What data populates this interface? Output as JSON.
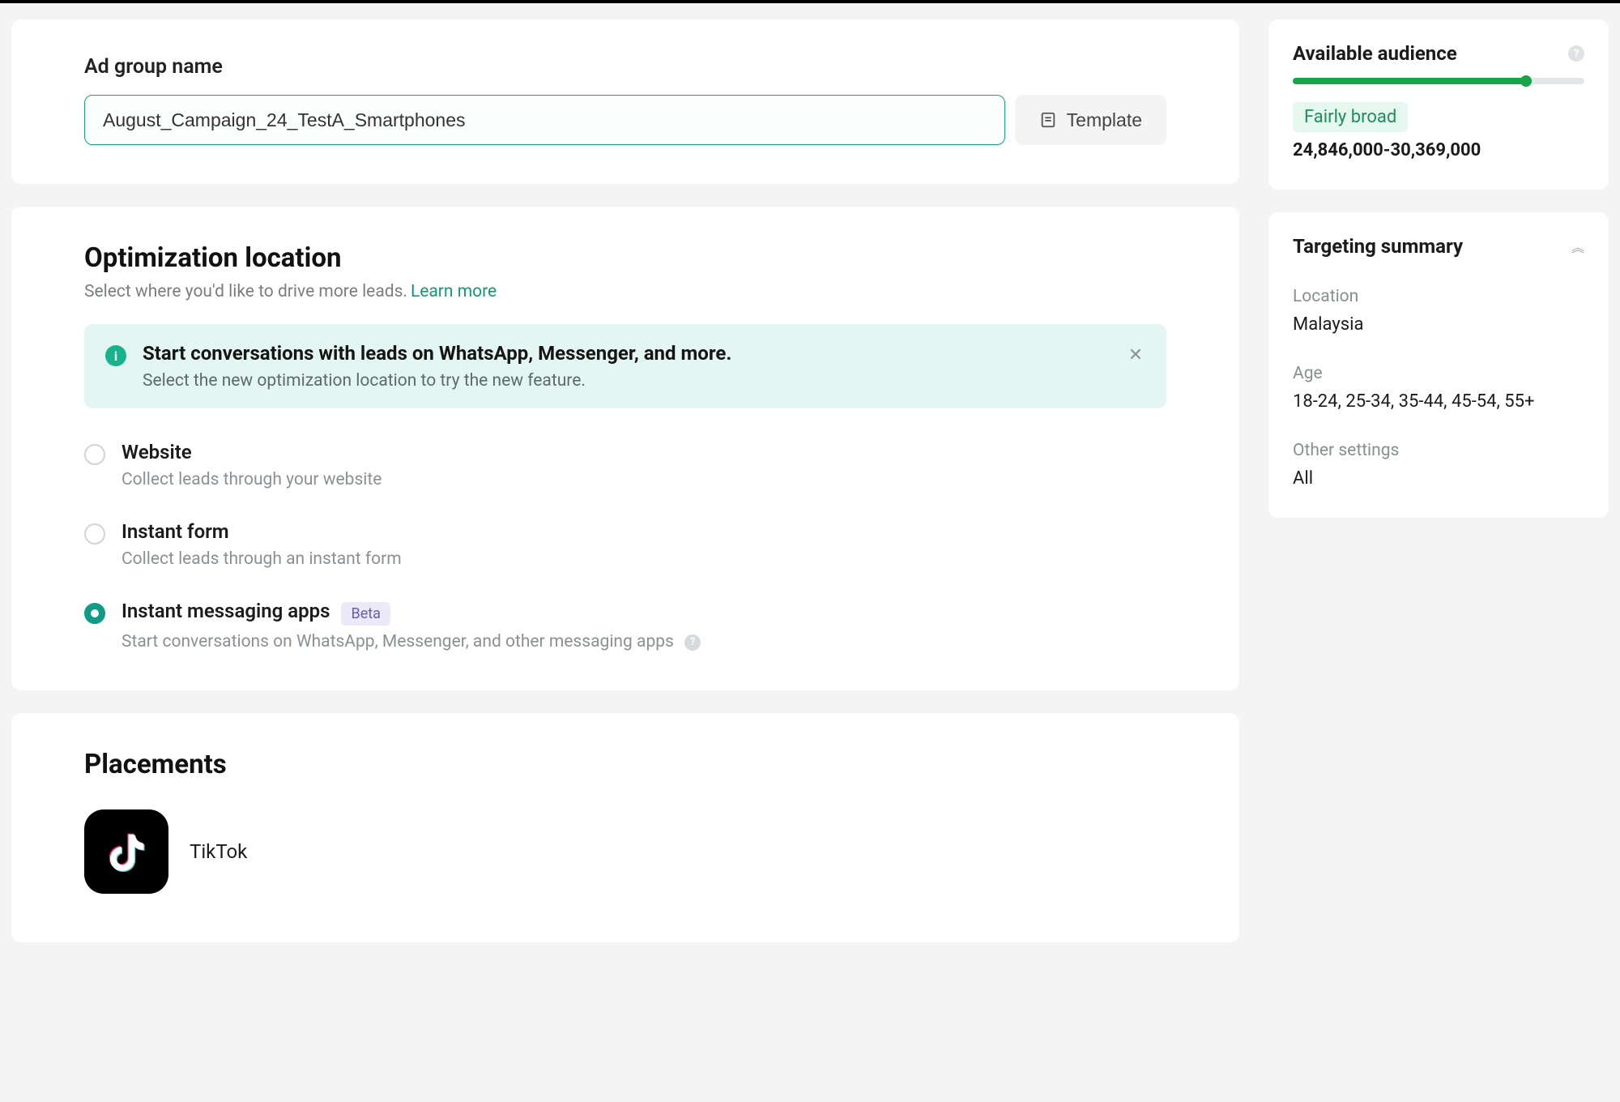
{
  "adGroup": {
    "label": "Ad group name",
    "value": "August_Campaign_24_TestA_Smartphones",
    "templateButton": "Template"
  },
  "optimization": {
    "title": "Optimization location",
    "subtitle": "Select where you'd like to drive more leads.",
    "learnMore": "Learn more",
    "banner": {
      "title": "Start conversations with leads on WhatsApp, Messenger, and more.",
      "body": "Select the new optimization location to try the new feature."
    },
    "options": [
      {
        "label": "Website",
        "desc": "Collect leads through your website",
        "selected": false
      },
      {
        "label": "Instant form",
        "desc": "Collect leads through an instant form",
        "selected": false
      },
      {
        "label": "Instant messaging apps",
        "desc": "Start conversations on WhatsApp, Messenger, and other messaging apps",
        "selected": true,
        "betaBadge": "Beta"
      }
    ]
  },
  "placements": {
    "title": "Placements",
    "items": [
      {
        "name": "TikTok"
      }
    ]
  },
  "side": {
    "audience": {
      "title": "Available audience",
      "statusLabel": "Fairly broad",
      "range": "24,846,000-30,369,000",
      "meterPercent": 80
    },
    "targeting": {
      "title": "Targeting summary",
      "rows": [
        {
          "label": "Location",
          "value": "Malaysia"
        },
        {
          "label": "Age",
          "value": "18-24, 25-34, 35-44, 45-54, 55+"
        },
        {
          "label": "Other settings",
          "value": "All"
        }
      ]
    }
  }
}
